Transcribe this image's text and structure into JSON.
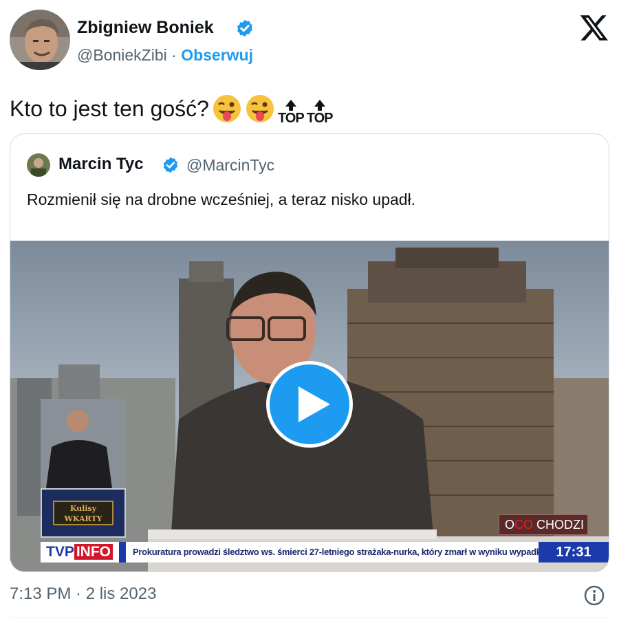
{
  "author": {
    "name": "Zbigniew Boniek",
    "handle": "@BoniekZibi",
    "separator": "·",
    "follow_label": "Obserwuj",
    "verified": true
  },
  "brand": {
    "logo_icon": "x-logo-icon"
  },
  "tweet": {
    "text": "Kto to jest ten gość?",
    "emojis": [
      "winking-face-with-tongue",
      "winking-face-with-tongue",
      "top-arrow",
      "top-arrow"
    ],
    "top_label_1": "TOP",
    "top_label_2": "TOP"
  },
  "quote": {
    "name": "Marcin Tyc",
    "handle": "@MarcinTyc",
    "text": "Rozmienił się na drobne wcześniej, a teraz nisko upadł.",
    "verified": true
  },
  "video": {
    "play_icon": "play-icon",
    "channel_logo_tvp": "TVP",
    "channel_logo_info": "INFO",
    "ticker_text": "Prokuratura prowadzi śledztwo ws. śmierci 27-letniego strażaka-nurka, który zmarł w wyniku wypadku podczas poszukiwań G. Borysa",
    "clock": "17:31",
    "show_tag_prefix": "O",
    "show_tag_accent": "CO",
    "show_tag_suffix": "CHODZI",
    "sign_logo_line1": "Kulisy",
    "sign_logo_line2": "WKARTY"
  },
  "footer": {
    "timestamp": "7:13 PM · 2 lis 2023",
    "info_icon": "info-icon"
  },
  "colors": {
    "accent": "#1d9bf0",
    "text": "#0f1419",
    "secondary": "#536471",
    "border": "#cfd9de",
    "tvp_blue": "#1c3aa9",
    "tvp_red": "#d1162a"
  }
}
